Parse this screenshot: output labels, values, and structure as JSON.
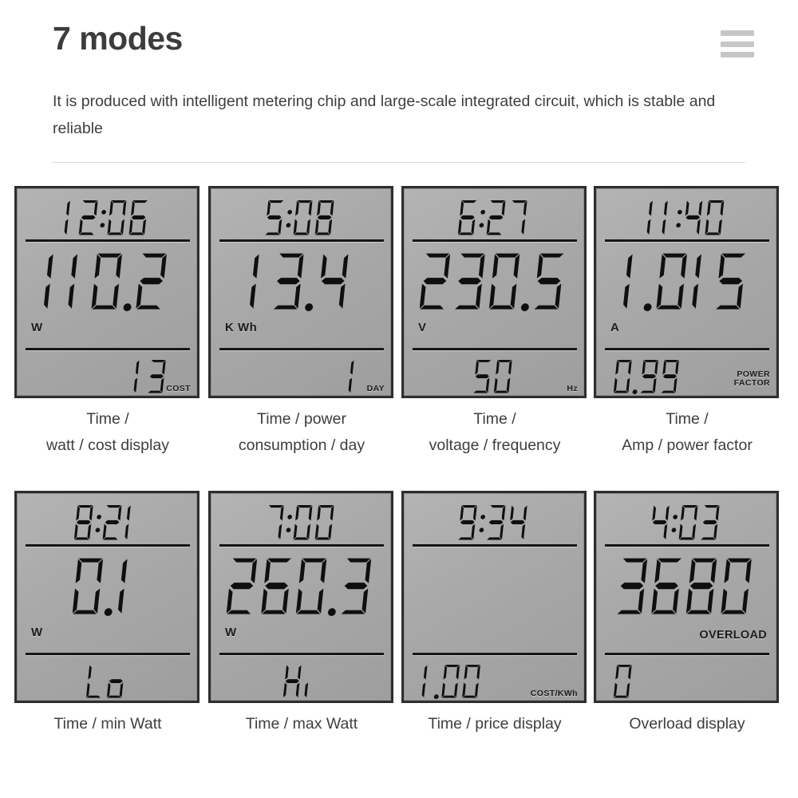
{
  "header": {
    "title": "7 modes",
    "subtitle": "It is produced with intelligent metering chip and large-scale integrated circuit, which is stable and reliable",
    "menu_icon": "hamburger-menu-icon"
  },
  "colors": {
    "title": "#3c3c3c",
    "body_text": "#3e3e3e",
    "menu_bar": "#c6c6c6",
    "rule": "#d9d9d9",
    "lcd_background": "#a9a9a9",
    "lcd_border": "#2e2e2e",
    "lcd_segment": "#0f0f0f"
  },
  "panels": [
    {
      "index": 1,
      "time": "12:06",
      "main": "110.2",
      "unit": "W",
      "unit_align": "left",
      "bottom": "13",
      "bottom_align": "right-ish",
      "sublabel": "COST",
      "sublabel_lines": [
        "COST"
      ],
      "caption_line1": "Time /",
      "caption_line2": "watt / cost display"
    },
    {
      "index": 2,
      "time": "5:08",
      "main": "13.4",
      "unit": "K Wh",
      "unit_align": "left",
      "bottom": "1",
      "bottom_align": "right-ish",
      "sublabel": "DAY",
      "sublabel_lines": [
        "DAY"
      ],
      "caption_line1": "Time / power",
      "caption_line2": "consumption / day"
    },
    {
      "index": 3,
      "time": "6:27",
      "main": "230.5",
      "unit": "V",
      "unit_align": "left",
      "bottom": "50",
      "bottom_align": "center",
      "sublabel": "Hz",
      "sublabel_lines": [
        "Hz"
      ],
      "caption_line1": "Time /",
      "caption_line2": "voltage / frequency"
    },
    {
      "index": 4,
      "time": "11:40",
      "main": "1.015",
      "unit": "A",
      "unit_align": "left",
      "bottom": "0.99",
      "bottom_align": "left-ish",
      "sublabel": "POWER FACTOR",
      "sublabel_lines": [
        "POWER",
        "FACTOR"
      ],
      "caption_line1": "Time /",
      "caption_line2": "Amp / power factor"
    },
    {
      "index": 5,
      "time": "8:21",
      "main": "0.1",
      "unit": "W",
      "unit_align": "left",
      "bottom": "Lo",
      "bottom_align": "center",
      "sublabel": "",
      "sublabel_lines": [],
      "caption_line1": "Time / min Watt",
      "caption_line2": ""
    },
    {
      "index": 6,
      "time": "7:00",
      "main": "260.3",
      "unit": "W",
      "unit_align": "left",
      "bottom": "Hi",
      "bottom_align": "center",
      "sublabel": "",
      "sublabel_lines": [],
      "caption_line1": "Time / max Watt",
      "caption_line2": ""
    },
    {
      "index": 7,
      "time": "9:34",
      "main": "",
      "unit": "",
      "unit_align": "left",
      "bottom": "1.00",
      "bottom_align": "left-ish",
      "sublabel": "COST/KWh",
      "sublabel_lines": [
        "COST/KWh"
      ],
      "caption_line1": "Time / price display",
      "caption_line2": ""
    },
    {
      "index": 8,
      "time": "4:03",
      "main": "3680",
      "unit": "OVERLOAD",
      "unit_align": "overload",
      "bottom": "0",
      "bottom_align": "left-ish2",
      "sublabel": "",
      "sublabel_lines": [],
      "caption_line1": "Overload display",
      "caption_line2": ""
    }
  ]
}
